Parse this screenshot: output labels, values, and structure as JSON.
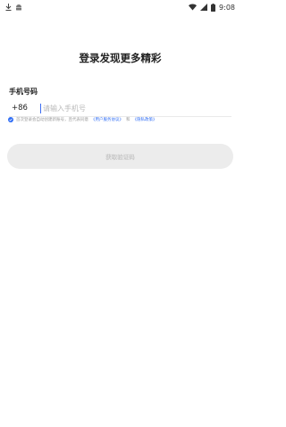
{
  "status_bar": {
    "time": "9:08",
    "icons": [
      "download-icon",
      "android-icon",
      "wifi-icon",
      "cell-signal-icon",
      "battery-icon"
    ]
  },
  "title": "登录发现更多精彩",
  "phone_field": {
    "label": "手机号码",
    "country_code": "+86",
    "placeholder": "请输入手机号",
    "value": ""
  },
  "agreement": {
    "text_before": "首次登录会自动创建新账号，且代表同意",
    "link_user": "《用户服务协议》",
    "conjunction": "和",
    "link_privacy": "《隐私政策》",
    "checked": true
  },
  "submit": {
    "label": "获取验证码"
  },
  "colors": {
    "accent": "#2f6df5",
    "button_disabled_bg": "#ececec",
    "button_disabled_text": "#c7c7c7"
  }
}
